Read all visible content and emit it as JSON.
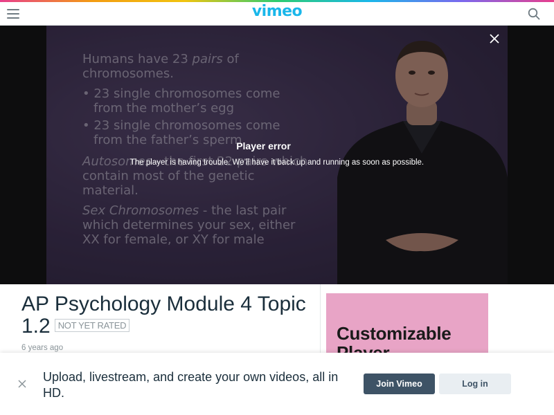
{
  "header": {
    "logo_text": "vimeo",
    "menu_icon": "hamburger-menu-icon",
    "search_icon": "search-icon",
    "accent_color": "#1ab7ea"
  },
  "player": {
    "slide": {
      "line1_a": "Humans have 23 ",
      "line1_em": "pairs",
      "line1_b": " of chromosomes.",
      "bullet1": "• 23 single chromosomes come from the mother’s egg",
      "bullet2": "• 23 single chromosomes come from the father’s sperm",
      "autosomes_term": "Autosomes",
      "autosomes_def": " - the first 22 pairs which contain most of the genetic material.",
      "sex_term": "Sex Chromosomes",
      "sex_def": " - the last pair which determines your sex, either XX for female, or XY for male"
    },
    "error_title": "Player error",
    "error_message": "The player is having trouble. We’ll have it back up and running as soon as possible.",
    "close_icon": "close-icon"
  },
  "video": {
    "title": "AP Psychology Module 4 Topic 1.2",
    "rating_badge": "NOT YET RATED",
    "age": "6 years ago"
  },
  "ad": {
    "headline": "Customizable Player",
    "background_color": "#e8a4c6"
  },
  "signup_banner": {
    "message": "Upload, livestream, and create your own videos, all in HD.",
    "join_label": "Join Vimeo",
    "login_label": "Log in",
    "close_icon": "close-icon",
    "join_color": "#3e5366"
  }
}
